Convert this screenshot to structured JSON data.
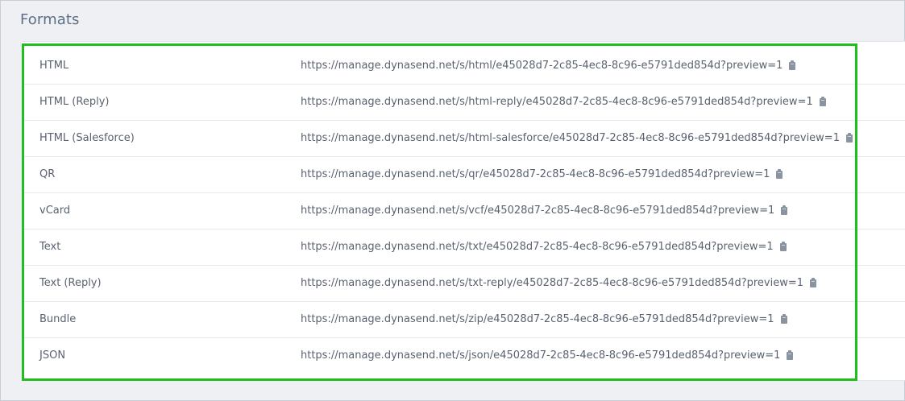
{
  "section": {
    "title": "Formats"
  },
  "highlight_color": "#1fbf1f",
  "formats": [
    {
      "name": "HTML",
      "url": "https://manage.dynasend.net/s/html/e45028d7-2c85-4ec8-8c96-e5791ded854d?preview=1"
    },
    {
      "name": "HTML (Reply)",
      "url": "https://manage.dynasend.net/s/html-reply/e45028d7-2c85-4ec8-8c96-e5791ded854d?preview=1"
    },
    {
      "name": "HTML (Salesforce)",
      "url": "https://manage.dynasend.net/s/html-salesforce/e45028d7-2c85-4ec8-8c96-e5791ded854d?preview=1"
    },
    {
      "name": "QR",
      "url": "https://manage.dynasend.net/s/qr/e45028d7-2c85-4ec8-8c96-e5791ded854d?preview=1"
    },
    {
      "name": "vCard",
      "url": "https://manage.dynasend.net/s/vcf/e45028d7-2c85-4ec8-8c96-e5791ded854d?preview=1"
    },
    {
      "name": "Text",
      "url": "https://manage.dynasend.net/s/txt/e45028d7-2c85-4ec8-8c96-e5791ded854d?preview=1"
    },
    {
      "name": "Text (Reply)",
      "url": "https://manage.dynasend.net/s/txt-reply/e45028d7-2c85-4ec8-8c96-e5791ded854d?preview=1"
    },
    {
      "name": "Bundle",
      "url": "https://manage.dynasend.net/s/zip/e45028d7-2c85-4ec8-8c96-e5791ded854d?preview=1"
    },
    {
      "name": "JSON",
      "url": "https://manage.dynasend.net/s/json/e45028d7-2c85-4ec8-8c96-e5791ded854d?preview=1"
    }
  ],
  "icons": {
    "copy": "clipboard-icon"
  }
}
